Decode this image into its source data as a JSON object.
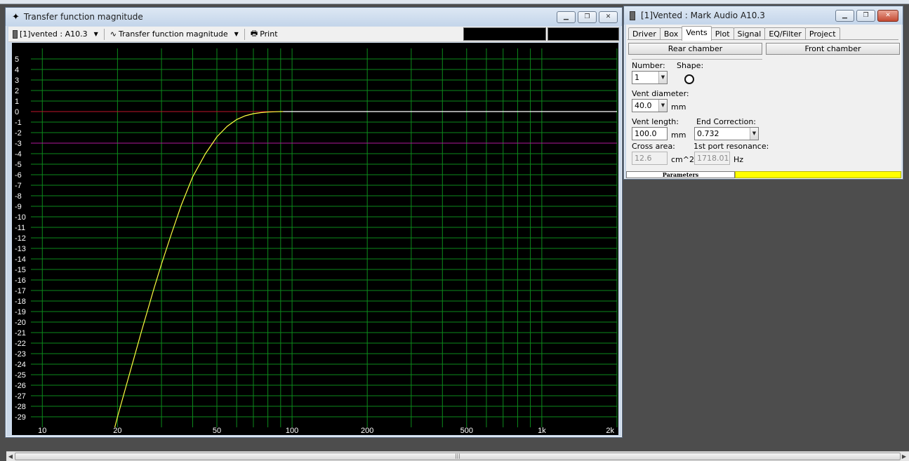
{
  "transfer_window": {
    "title": "Transfer function magnitude",
    "toolbar": {
      "project_select": "[1]vented : A10.3",
      "graph_select": "Transfer function magnitude",
      "print_label": "Print"
    }
  },
  "param_window": {
    "title": "[1]Vented : Mark Audio A10.3",
    "tabs": [
      "Driver",
      "Box",
      "Vents",
      "Plot",
      "Signal",
      "EQ/Filter",
      "Project"
    ],
    "active_tab": "Vents",
    "rear_chamber_label": "Rear chamber",
    "front_chamber_label": "Front chamber",
    "number_label": "Number:",
    "number_value": "1",
    "shape_label": "Shape:",
    "vent_diameter_label": "Vent diameter:",
    "vent_diameter_value": "40.0",
    "vent_diameter_unit": "mm",
    "vent_length_label": "Vent length:",
    "vent_length_value": "100.0",
    "vent_length_unit": "mm",
    "end_correction_label": "End Correction:",
    "end_correction_value": "0.732",
    "cross_area_label": "Cross area:",
    "cross_area_value": "12.6",
    "cross_area_unit": "cm^2",
    "port_resonance_label": "1st port resonance:",
    "port_resonance_value": "1718.01",
    "port_resonance_unit": "Hz",
    "status_parameters": "Parameters"
  },
  "chart_data": {
    "type": "line",
    "title": "",
    "xlabel": "",
    "ylabel": "",
    "x_scale": "log",
    "xlim": [
      9,
      2000
    ],
    "ylim": [
      -30,
      6
    ],
    "x_tick_labels": [
      {
        "value": 10,
        "label": "10"
      },
      {
        "value": 20,
        "label": "20"
      },
      {
        "value": 50,
        "label": "50"
      },
      {
        "value": 100,
        "label": "100"
      },
      {
        "value": 200,
        "label": "200"
      },
      {
        "value": 500,
        "label": "500"
      },
      {
        "value": 1000,
        "label": "1k"
      },
      {
        "value": 2000,
        "label": "2k"
      }
    ],
    "y_ticks": [
      5,
      4,
      3,
      2,
      1,
      0,
      -1,
      -2,
      -3,
      -4,
      -5,
      -6,
      -7,
      -8,
      -9,
      -10,
      -11,
      -12,
      -13,
      -14,
      -15,
      -16,
      -17,
      -18,
      -19,
      -20,
      -21,
      -22,
      -23,
      -24,
      -25,
      -26,
      -27,
      -28,
      -29
    ],
    "grid": true,
    "reference_lines": [
      {
        "y": 0,
        "color": "#c0142a"
      },
      {
        "y": -3,
        "color": "#b0189a"
      }
    ],
    "series": [
      {
        "color": "#ffff40",
        "x": [
          19.5,
          20,
          22,
          25,
          28,
          30,
          33,
          36,
          40,
          45,
          50,
          55,
          60,
          65,
          70,
          75,
          80,
          85,
          90,
          92
        ],
        "values": [
          -30,
          -29.0,
          -25.5,
          -20.8,
          -16.8,
          -14.5,
          -11.5,
          -8.9,
          -6.2,
          -4.0,
          -2.4,
          -1.4,
          -0.75,
          -0.4,
          -0.2,
          -0.1,
          -0.05,
          -0.02,
          0,
          0
        ]
      },
      {
        "color": "#ffffff",
        "x": [
          92,
          2000
        ],
        "values": [
          0,
          0
        ]
      }
    ]
  }
}
